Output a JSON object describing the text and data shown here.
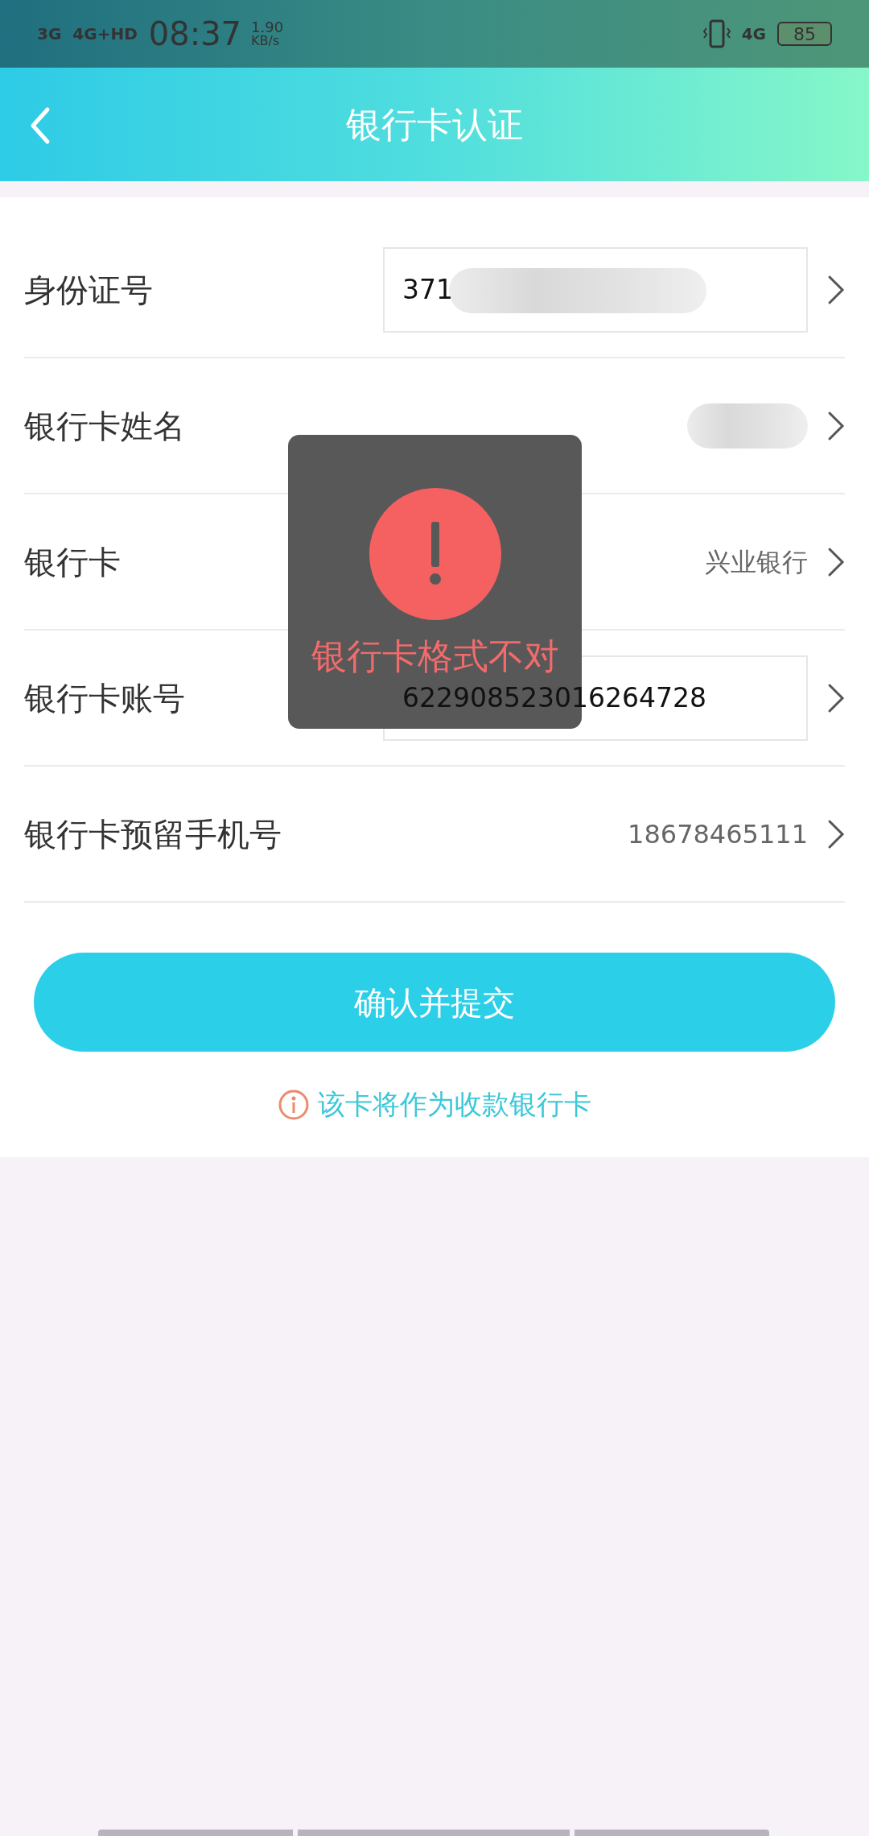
{
  "status_bar": {
    "network_1": "3G",
    "network_2": "4G+HD",
    "time": "08:37",
    "speed": "1.90",
    "speed_unit": "KB/s",
    "network_3": "4G",
    "battery": "85"
  },
  "header": {
    "title": "银行卡认证"
  },
  "form": {
    "rows": [
      {
        "label": "身份证号",
        "kind": "input",
        "value": "371",
        "redacted": true
      },
      {
        "label": "银行卡姓名",
        "kind": "text",
        "redacted": true
      },
      {
        "label": "银行卡",
        "kind": "text",
        "value": "兴业银行"
      },
      {
        "label": "银行卡账号",
        "kind": "input",
        "value": "622908523016264728"
      },
      {
        "label": "银行卡预留手机号",
        "kind": "text",
        "value": "18678465111"
      }
    ]
  },
  "submit_button": "确认并提交",
  "notice": "该卡将作为收款银行卡",
  "toast": {
    "message": "银行卡格式不对"
  }
}
